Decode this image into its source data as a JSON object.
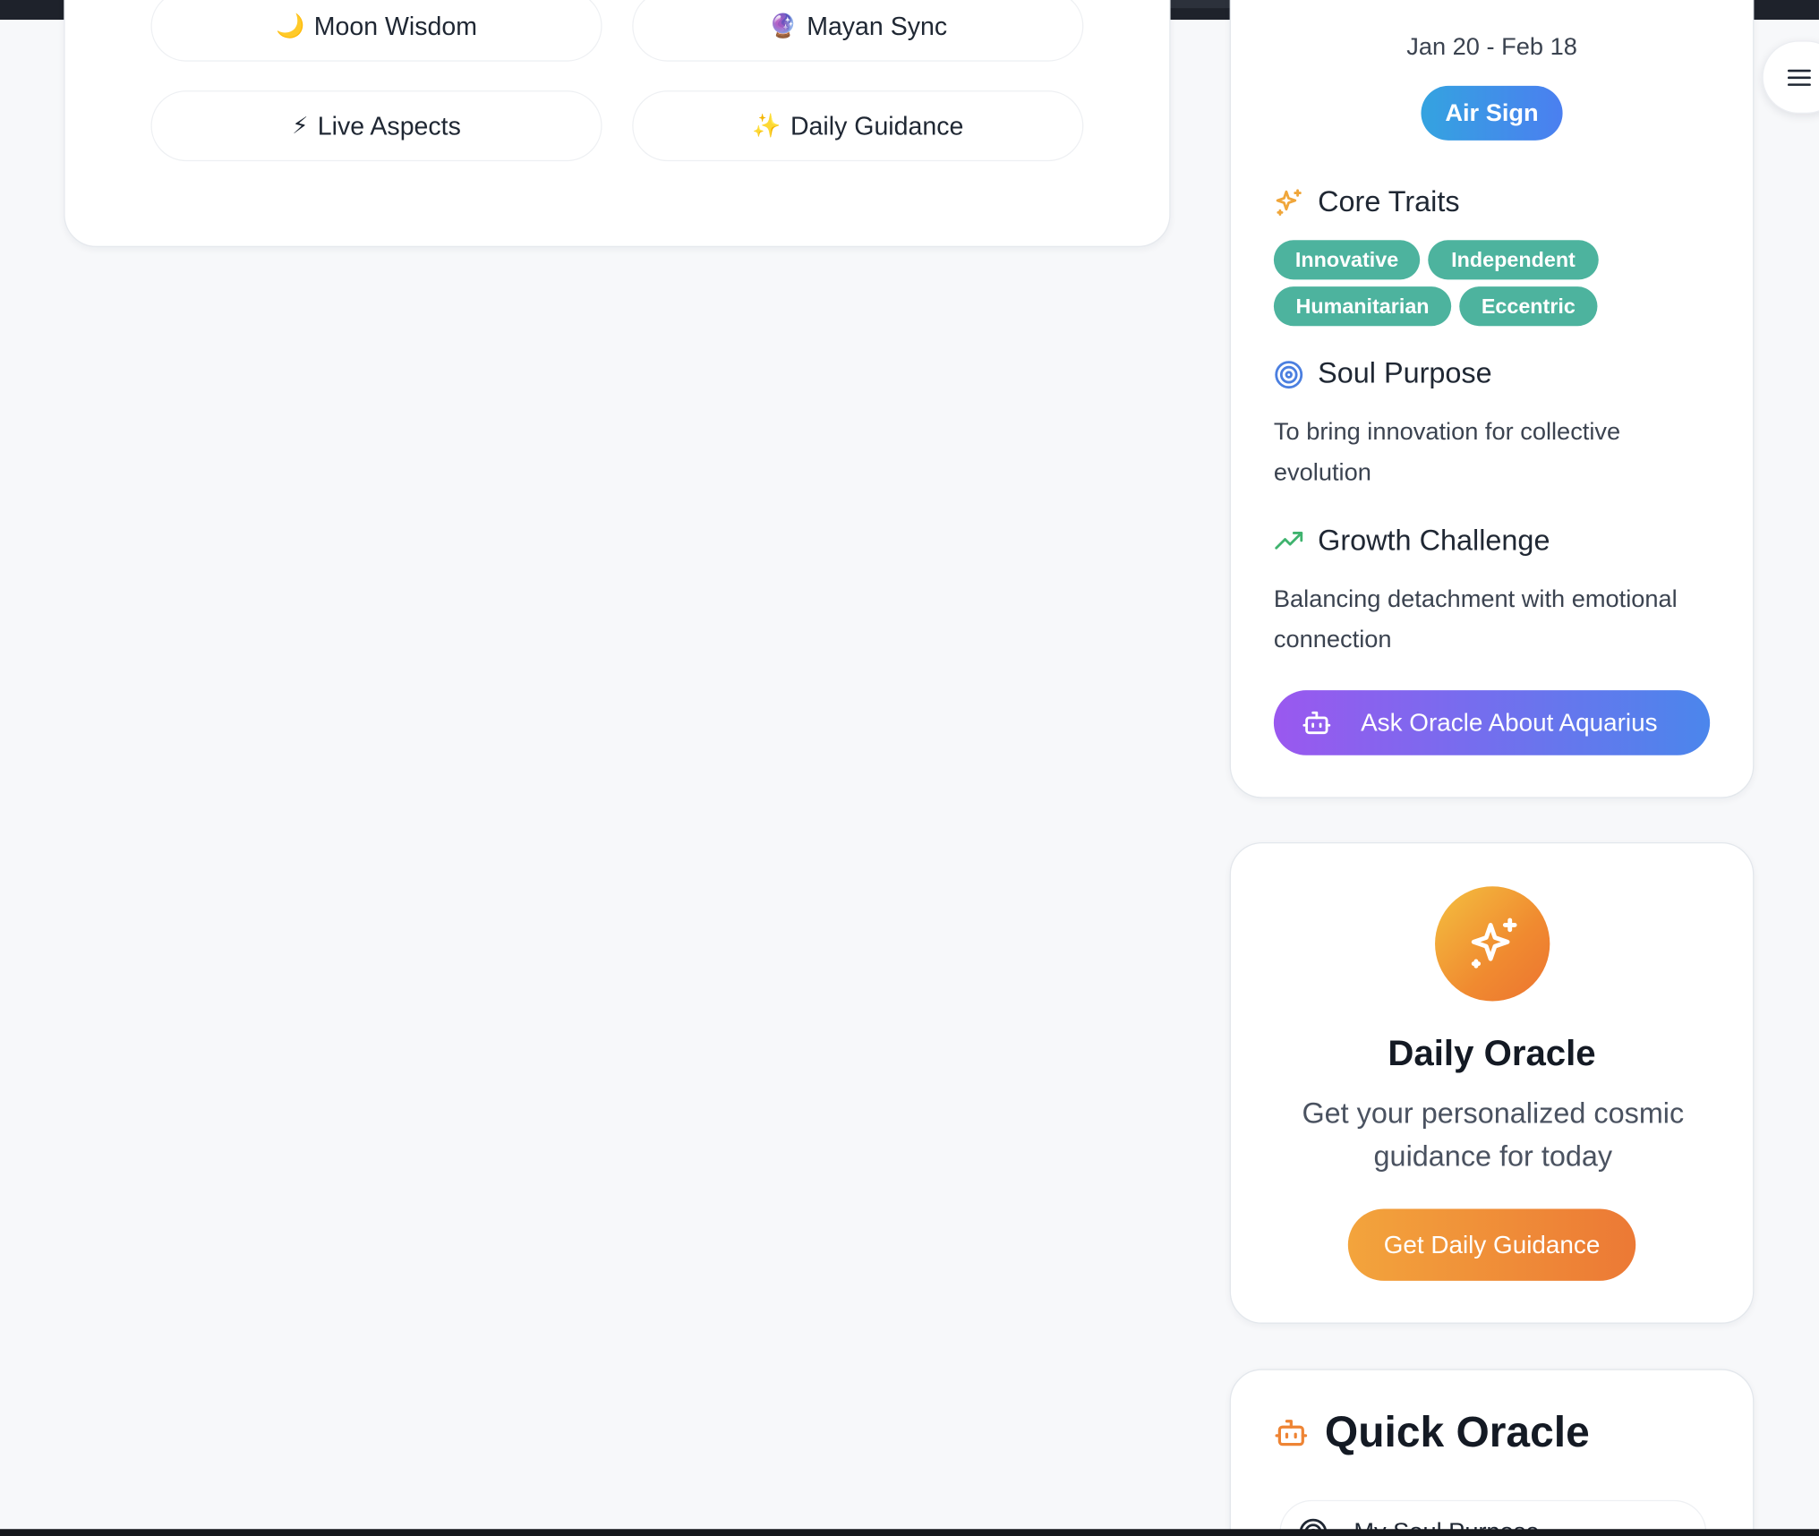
{
  "features": {
    "moon_wisdom": {
      "emoji": "🌙",
      "label": "Moon Wisdom"
    },
    "mayan_sync": {
      "emoji": "🔮",
      "label": "Mayan Sync"
    },
    "live_aspects": {
      "emoji": "⚡",
      "label": "Live Aspects"
    },
    "daily_guidance": {
      "emoji": "✨",
      "label": "Daily Guidance"
    }
  },
  "sign_card": {
    "date_range": "Jan 20 - Feb 18",
    "element_badge": "Air Sign",
    "core_traits_title": "Core Traits",
    "traits": [
      "Innovative",
      "Independent",
      "Humanitarian",
      "Eccentric"
    ],
    "soul_purpose_title": "Soul Purpose",
    "soul_purpose_text": "To bring innovation for collective evolution",
    "growth_challenge_title": "Growth Challenge",
    "growth_challenge_text": "Balancing detachment with emotional connection",
    "ask_button": "Ask Oracle About Aquarius"
  },
  "daily_oracle": {
    "title": "Daily Oracle",
    "description": "Get your personalized cosmic guidance for today",
    "button": "Get Daily Guidance"
  },
  "quick_oracle": {
    "title": "Quick Oracle",
    "first_item": "My Soul Purpose"
  },
  "colors": {
    "trait_green": "#4db39e",
    "air_badge": "#3b94e6",
    "ask_gradient_start": "#9a58ef",
    "ask_gradient_end": "#4b86ec",
    "oracle_orange": "#ee8434"
  },
  "icons": {
    "core_traits": "sparkles-icon",
    "soul_purpose": "target-icon",
    "growth_challenge": "trending-up-icon",
    "ask": "bot-icon",
    "daily_oracle": "sparkles-icon",
    "quick_oracle": "bot-icon",
    "quick_item": "target-icon",
    "menu": "hamburger-icon"
  }
}
